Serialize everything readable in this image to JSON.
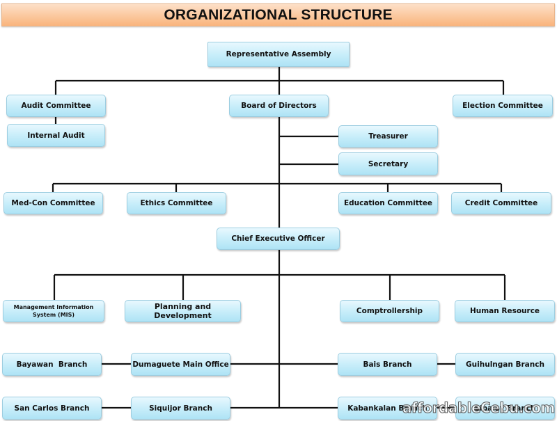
{
  "title": "ORGANIZATIONAL STRUCTURE",
  "nodes": {
    "representative_assembly": "Representative Assembly",
    "audit_committee": "Audit Committee",
    "internal_audit": "Internal Audit",
    "board_of_directors": "Board of Directors",
    "election_committee": "Election Committee",
    "treasurer": "Treasurer",
    "secretary": "Secretary",
    "medcon_committee": "Med-Con Committee",
    "ethics_committee": "Ethics Committee",
    "education_committee": "Education Committee",
    "credit_committee": "Credit Committee",
    "ceo": "Chief Executive Officer",
    "mis": "Management Information System (MIS)",
    "planning": "Planning and Development",
    "comptrollership": "Comptrollership",
    "human_resource": "Human Resource",
    "bayawan": "Bayawan  Branch",
    "dumaguete": "Dumaguete Main Office",
    "bais": "Bais Branch",
    "guihulngan": "Guihulngan Branch",
    "san_carlos": "San Carlos Branch",
    "siquijor": "Siquijor Branch",
    "kabankalan": "Kabankalan Branch",
    "sipalay": "Sipalay Branch"
  },
  "watermark": "affordableCebu.com"
}
